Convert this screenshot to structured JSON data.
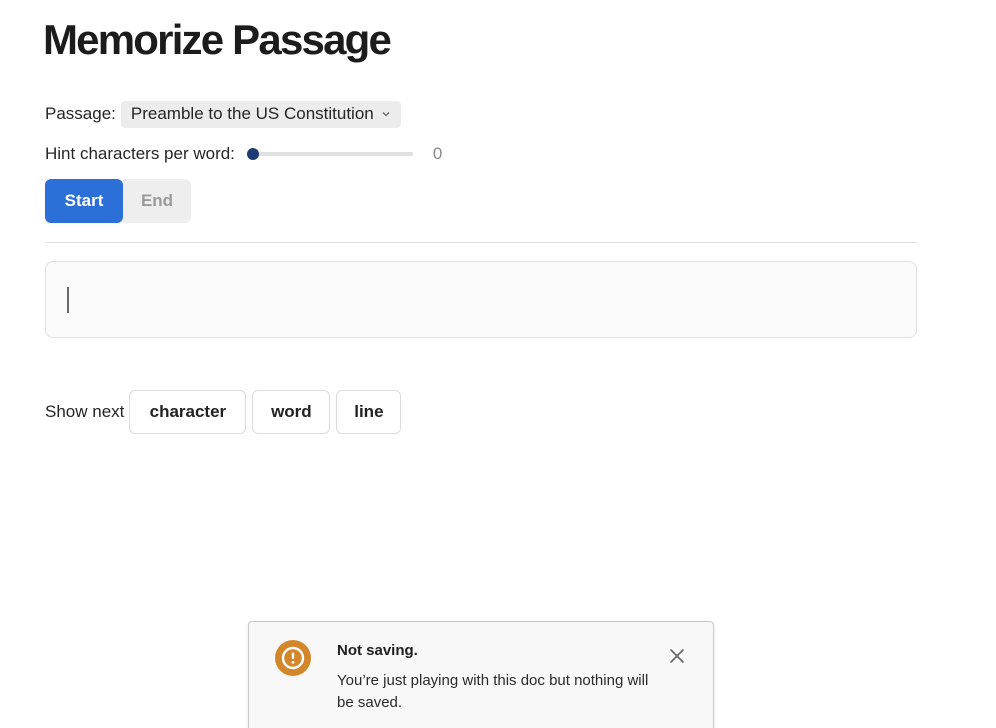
{
  "page": {
    "title": "Memorize Passage"
  },
  "passage": {
    "label": "Passage:",
    "selected": "Preamble to the US Constitution"
  },
  "hint": {
    "label": "Hint characters per word:",
    "value": "0",
    "level": 0
  },
  "controls": {
    "start_label": "Start",
    "end_label": "End"
  },
  "show_next": {
    "label": "Show next",
    "character_label": "character",
    "word_label": "word",
    "line_label": "line"
  },
  "toast": {
    "title": "Not saving.",
    "message": "You’re just playing with this doc but nothing will be saved.",
    "icon": "warning-icon",
    "accent_color": "#d4862b"
  },
  "colors": {
    "primary": "#2c6fd6",
    "slider_thumb": "#1e3a72"
  }
}
